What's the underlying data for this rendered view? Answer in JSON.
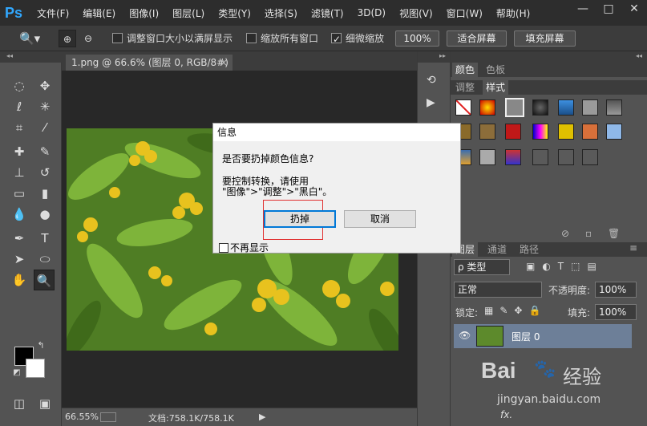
{
  "app": {
    "logo": "Ps"
  },
  "menu": [
    "文件(F)",
    "编辑(E)",
    "图像(I)",
    "图层(L)",
    "类型(Y)",
    "选择(S)",
    "滤镜(T)",
    "3D(D)",
    "视图(V)",
    "窗口(W)",
    "帮助(H)"
  ],
  "window_controls": {
    "minimize": "—",
    "maximize": "□",
    "close": "✕"
  },
  "options": {
    "resize_windows": "调整窗口大小以满屏显示",
    "zoom_all": "缩放所有窗口",
    "scrubby_zoom": "细微缩放",
    "zoom_100": "100%",
    "fit_screen": "适合屏幕",
    "fill_screen": "填充屏幕"
  },
  "document": {
    "tab_title": "1.png @ 66.6% (图层 0, RGB/8#)",
    "close": "×"
  },
  "status": {
    "zoom": "66.55%",
    "doc_size": "文档:758.1K/758.1K",
    "arrow": "▶"
  },
  "panels": {
    "top_tabs": [
      "颜色",
      "色板"
    ],
    "mid_tabs": [
      "调整",
      "样式"
    ],
    "layer_tabs": [
      "图层",
      "通道",
      "路径"
    ],
    "filter_kind": "ρ 类型",
    "blend_mode": "正常",
    "opacity_label": "不透明度:",
    "opacity_value": "100%",
    "lock_label": "锁定:",
    "fill_label": "填充:",
    "fill_value": "100%",
    "layer_name": "图层 0",
    "fx": "fx."
  },
  "dialog": {
    "title": "信息",
    "question": "是否要扔掉颜色信息?",
    "hint_line1": "要控制转换，请使用",
    "hint_line2": "\"图像\">\"调整\">\"黑白\"。",
    "confirm": "扔掉",
    "cancel": "取消",
    "dont_show": "不再显示"
  },
  "watermark": {
    "brand": "Bai",
    "brand_suffix": "经验",
    "url": "jingyan.baidu.com"
  }
}
